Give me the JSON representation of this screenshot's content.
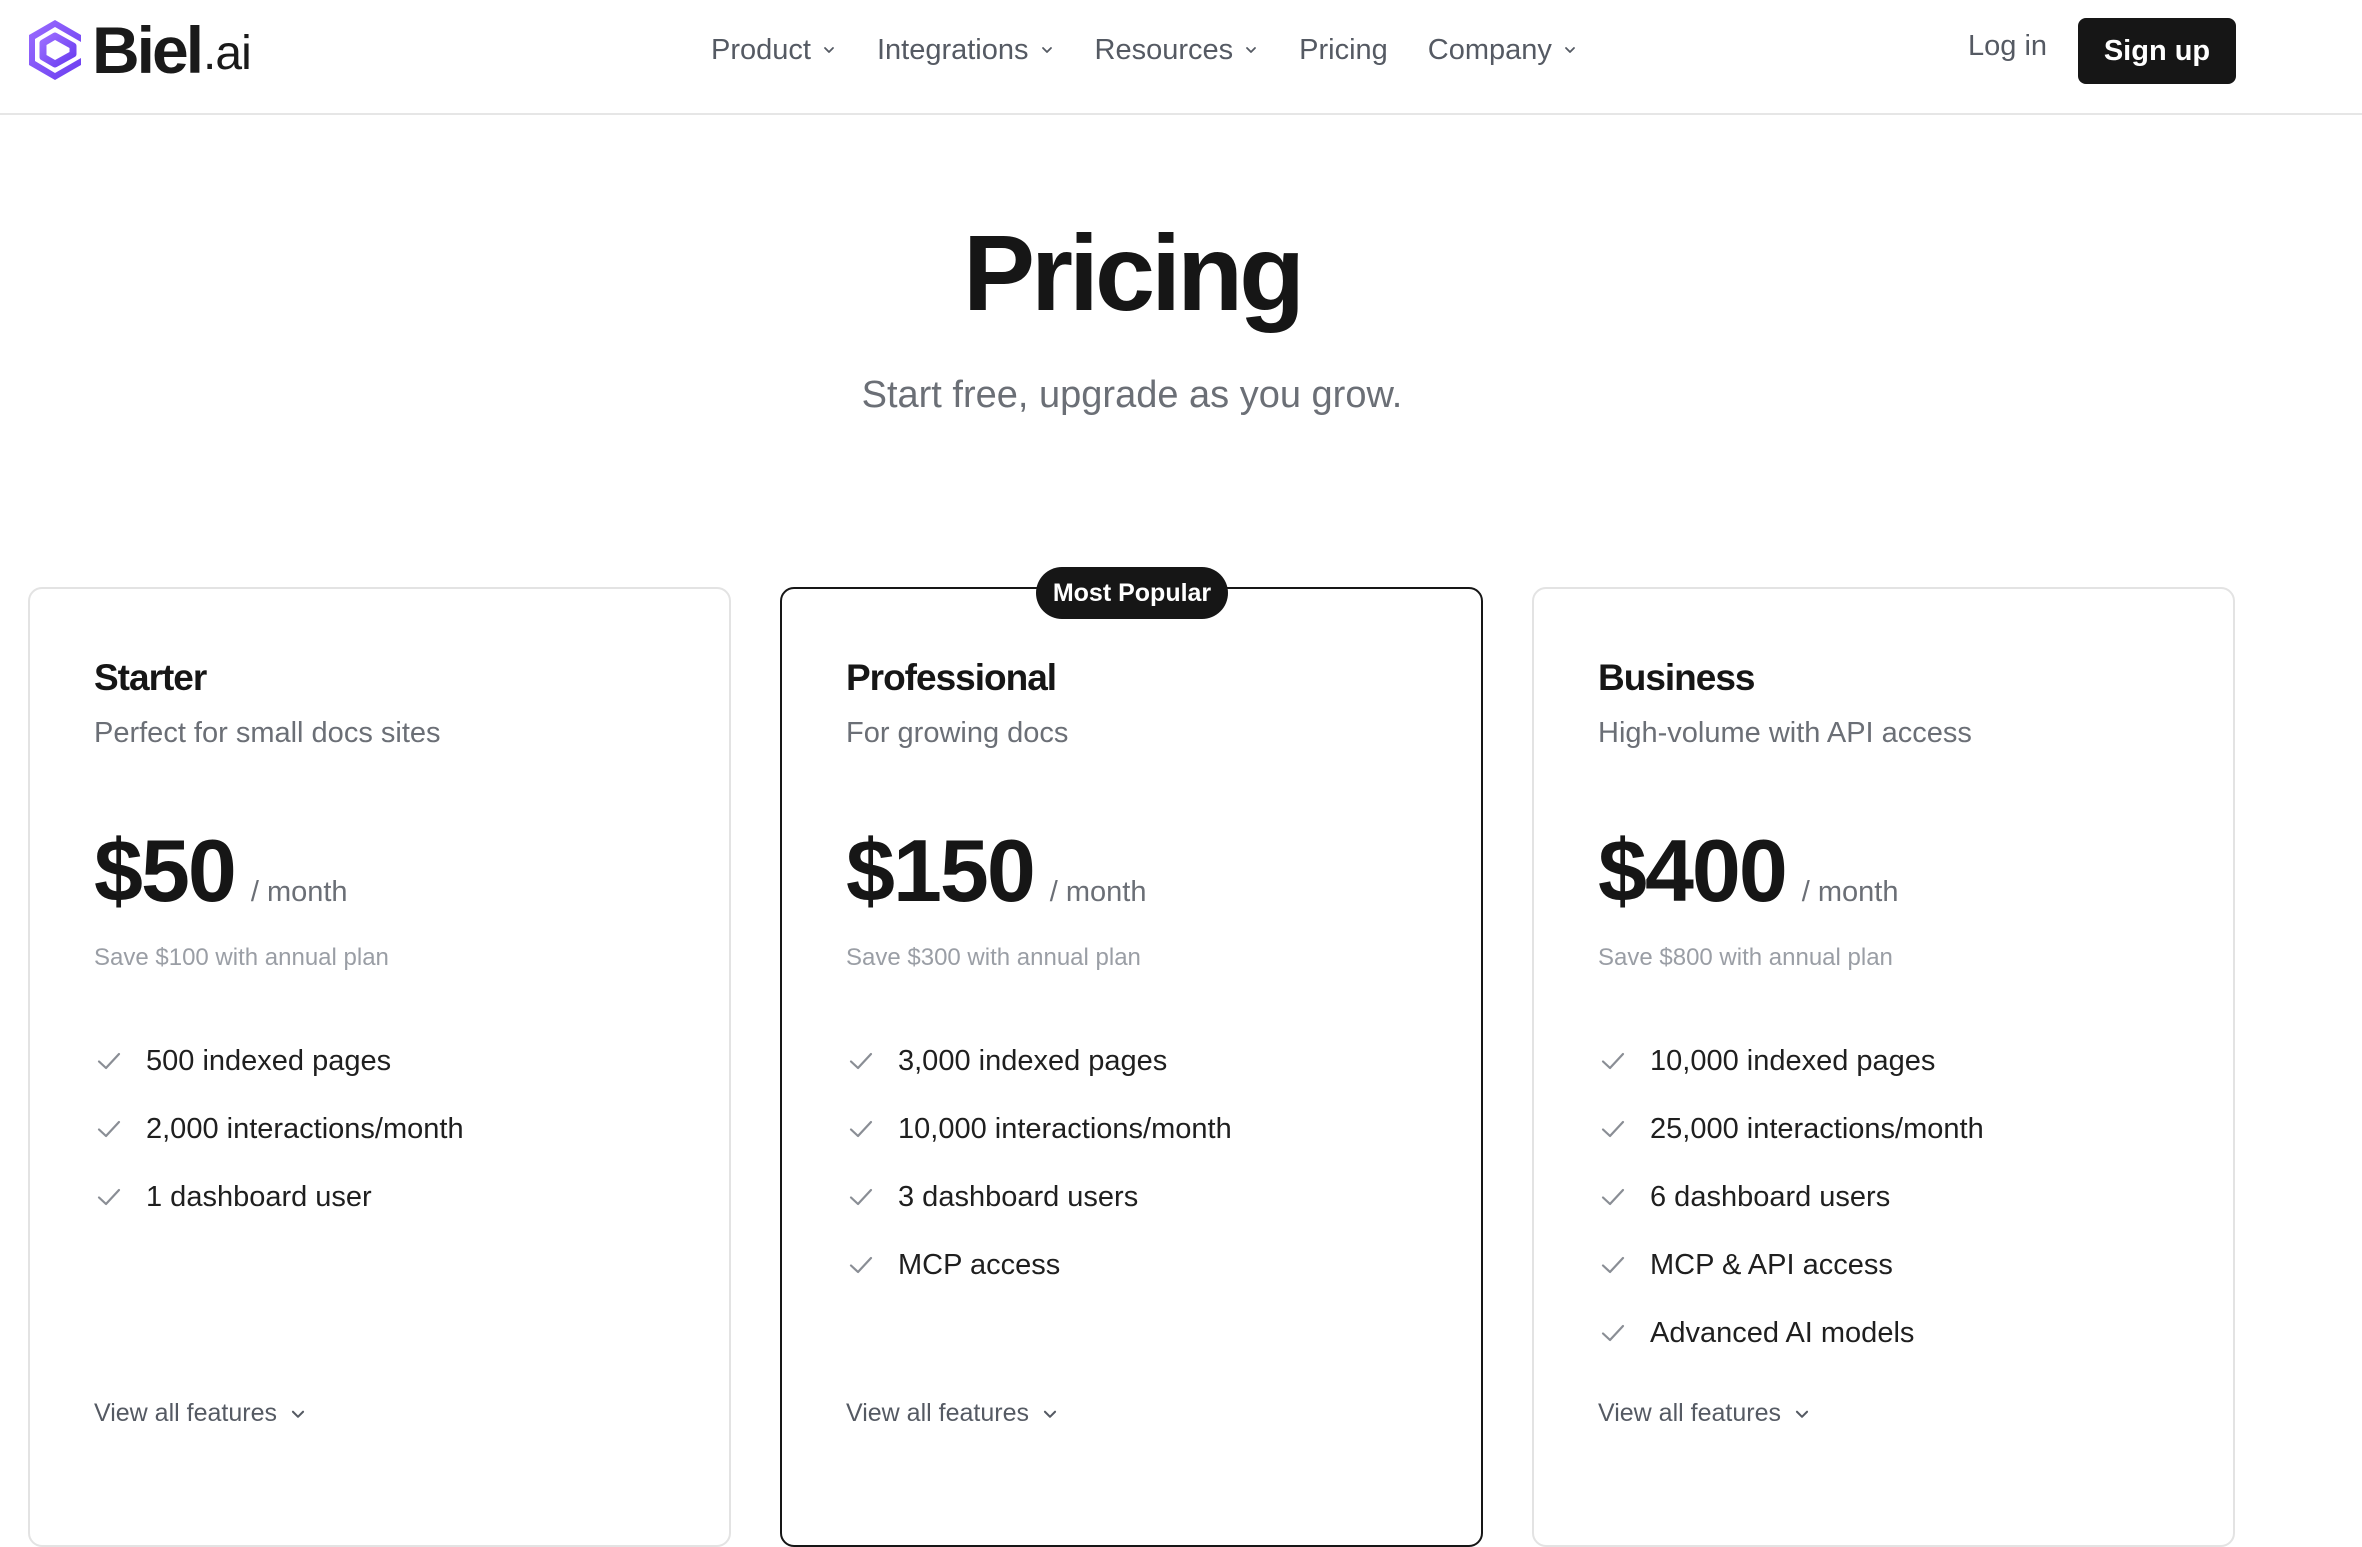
{
  "brand": {
    "name": "Biel",
    "suffix": ".ai",
    "accent": "#7c4dff",
    "icon": "biel-logo-icon"
  },
  "nav": {
    "items": [
      {
        "label": "Product",
        "has_dropdown": true
      },
      {
        "label": "Integrations",
        "has_dropdown": true
      },
      {
        "label": "Resources",
        "has_dropdown": true
      },
      {
        "label": "Pricing",
        "has_dropdown": false
      },
      {
        "label": "Company",
        "has_dropdown": true
      }
    ],
    "login": "Log in",
    "signup": "Sign up"
  },
  "hero": {
    "title": "Pricing",
    "subtitle": "Start free, upgrade as you grow."
  },
  "plans": [
    {
      "name": "Starter",
      "description": "Perfect for small docs sites",
      "price": "$50",
      "period": "/ month",
      "savings": "Save $100 with annual plan",
      "features": [
        "500 indexed pages",
        "2,000 interactions/month",
        "1 dashboard user"
      ],
      "view_all": "View all features",
      "featured": false
    },
    {
      "name": "Professional",
      "description": "For growing docs",
      "price": "$150",
      "period": "/ month",
      "savings": "Save $300 with annual plan",
      "features": [
        "3,000 indexed pages",
        "10,000 interactions/month",
        "3 dashboard users",
        "MCP access"
      ],
      "view_all": "View all features",
      "featured": true,
      "badge": "Most Popular"
    },
    {
      "name": "Business",
      "description": "High-volume with API access",
      "price": "$400",
      "period": "/ month",
      "savings": "Save $800 with annual plan",
      "features": [
        "10,000 indexed pages",
        "25,000 interactions/month",
        "6 dashboard users",
        "MCP & API access",
        "Advanced AI models"
      ],
      "view_all": "View all features",
      "featured": false
    }
  ],
  "colors": {
    "text": "#161616",
    "muted": "#6b6f76",
    "check": "#8a8e95",
    "button_bg": "#161616"
  }
}
